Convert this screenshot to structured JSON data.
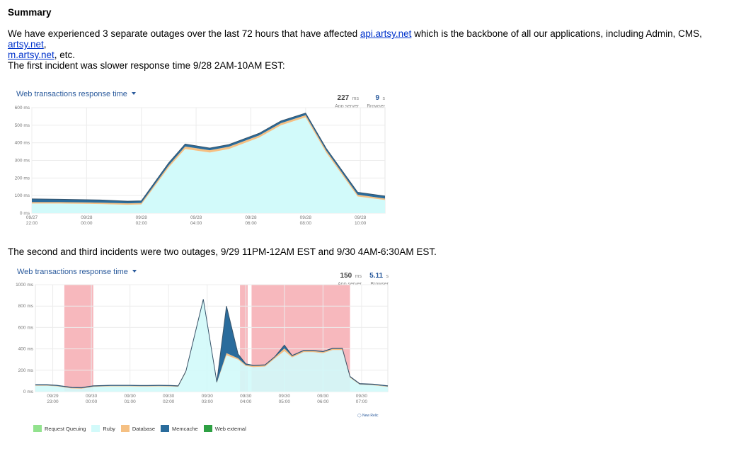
{
  "doc": {
    "heading": "Summary",
    "intro_prefix": "We have experienced 3 separate outages over the last 72 hours that have affected ",
    "link_api": "api.artsy.net",
    "intro_mid": " which is the backbone of all our applications, including Admin, CMS, ",
    "link_artsy": "artsy.net",
    "intro_sep": ",",
    "link_mobile": "m.artsy.net",
    "intro_suffix": ", etc.",
    "first_incident": "The first incident was slower response time 9/28 2AM-10AM EST:",
    "second_incident": "The second and third incidents were two outages, 9/29 11PM-12AM EST and 9/30 4AM-6:30AM EST."
  },
  "colors": {
    "ruby": "#d2fafa",
    "database": "#f5c083",
    "memcache": "#2a6c9c",
    "request_queuing": "#92e28e",
    "web_external": "#2ea043",
    "outage": "#f7b8bd",
    "link": "#0033cc"
  },
  "legend": [
    {
      "label": "Request Queuing",
      "color": "#92e28e"
    },
    {
      "label": "Ruby",
      "color": "#d2fafa"
    },
    {
      "label": "Database",
      "color": "#f5c083"
    },
    {
      "label": "Memcache",
      "color": "#2a6c9c"
    },
    {
      "label": "Web external",
      "color": "#2ea043"
    }
  ],
  "watermark": "New Relic",
  "chart_data": [
    {
      "type": "area",
      "title": "Web transactions response time",
      "metrics": [
        {
          "value": "227",
          "unit": "ms",
          "label": "App server"
        },
        {
          "value": "9",
          "unit": "s",
          "label": "Browser"
        }
      ],
      "ylim": [
        0,
        600
      ],
      "yticks": [
        0,
        100,
        200,
        300,
        400,
        500,
        600
      ],
      "ytick_labels": [
        "0 ms",
        "100 ms",
        "200 ms",
        "300 ms",
        "400 ms",
        "500 ms",
        "600 ms"
      ],
      "xlim": [
        -2,
        10.9
      ],
      "xticks": [
        -2,
        0,
        2,
        4,
        6,
        8,
        10
      ],
      "xtick_labels": [
        [
          "09/27",
          "22:00"
        ],
        [
          "09/28",
          "00:00"
        ],
        [
          "09/28",
          "02:00"
        ],
        [
          "09/28",
          "04:00"
        ],
        [
          "09/28",
          "06:00"
        ],
        [
          "09/28",
          "08:00"
        ],
        [
          "09/28",
          "10:00"
        ]
      ],
      "x": [
        -2,
        -1,
        0.5,
        1.5,
        2,
        3,
        3.6,
        4.5,
        5.2,
        6.3,
        7.1,
        8,
        8.75,
        9.9,
        10.9
      ],
      "series": [
        {
          "name": "Ruby",
          "values": [
            55,
            55,
            52,
            48,
            50,
            260,
            365,
            345,
            365,
            430,
            500,
            545,
            345,
            95,
            75
          ]
        },
        {
          "name": "Database",
          "values": [
            8,
            8,
            8,
            8,
            8,
            12,
            14,
            13,
            13,
            12,
            12,
            12,
            12,
            10,
            8
          ]
        },
        {
          "name": "Memcache",
          "values": [
            18,
            16,
            15,
            12,
            12,
            14,
            14,
            12,
            12,
            12,
            12,
            12,
            12,
            14,
            14
          ]
        }
      ]
    },
    {
      "type": "area",
      "title": "Web transactions response time",
      "metrics": [
        {
          "value": "150",
          "unit": "ms",
          "label": "App server"
        },
        {
          "value": "5.11",
          "unit": "s",
          "label": "Browser"
        }
      ],
      "ylim": [
        0,
        1000
      ],
      "yticks": [
        0,
        200,
        400,
        600,
        800,
        1000
      ],
      "ytick_labels": [
        "0 ms",
        "200 ms",
        "400 ms",
        "600 ms",
        "800 ms",
        "1000 ms"
      ],
      "xlim": [
        22.55,
        31.68
      ],
      "xticks": [
        23,
        24,
        25,
        26,
        27,
        28,
        29,
        30,
        31
      ],
      "xtick_labels": [
        [
          "09/29",
          "23:00"
        ],
        [
          "09/30",
          "00:00"
        ],
        [
          "09/30",
          "01:00"
        ],
        [
          "09/30",
          "02:00"
        ],
        [
          "09/30",
          "03:00"
        ],
        [
          "09/30",
          "04:00"
        ],
        [
          "09/30",
          "05:00"
        ],
        [
          "09/30",
          "06:00"
        ],
        [
          "09/30",
          "07:00"
        ]
      ],
      "outages": [
        [
          23.3,
          24.05
        ],
        [
          27.85,
          28.05
        ],
        [
          28.15,
          30.7
        ]
      ],
      "x": [
        22.55,
        22.85,
        23.1,
        23.5,
        23.75,
        24.05,
        24.5,
        24.75,
        25.0,
        25.25,
        25.45,
        25.75,
        26.05,
        26.25,
        26.45,
        26.9,
        27.25,
        27.5,
        27.8,
        28.0,
        28.2,
        28.5,
        28.75,
        29.0,
        29.2,
        29.5,
        29.75,
        30.0,
        30.25,
        30.5,
        30.7,
        30.95,
        31.3,
        31.68
      ],
      "series": [
        {
          "name": "Ruby",
          "values": [
            55,
            55,
            50,
            30,
            28,
            45,
            50,
            50,
            50,
            48,
            48,
            50,
            48,
            45,
            180,
            850,
            80,
            340,
            300,
            240,
            230,
            235,
            310,
            380,
            320,
            370,
            370,
            360,
            390,
            390,
            130,
            65,
            60,
            45
          ]
        },
        {
          "name": "Database",
          "values": [
            4,
            4,
            4,
            4,
            4,
            4,
            4,
            4,
            4,
            4,
            4,
            4,
            4,
            4,
            6,
            6,
            4,
            20,
            12,
            10,
            10,
            10,
            10,
            25,
            12,
            10,
            10,
            10,
            10,
            10,
            6,
            4,
            4,
            4
          ]
        },
        {
          "name": "Memcache",
          "values": [
            6,
            6,
            6,
            6,
            6,
            6,
            6,
            6,
            6,
            6,
            6,
            6,
            6,
            6,
            6,
            8,
            6,
            440,
            40,
            10,
            6,
            6,
            6,
            30,
            6,
            6,
            6,
            6,
            6,
            6,
            6,
            6,
            6,
            6
          ]
        }
      ]
    }
  ]
}
